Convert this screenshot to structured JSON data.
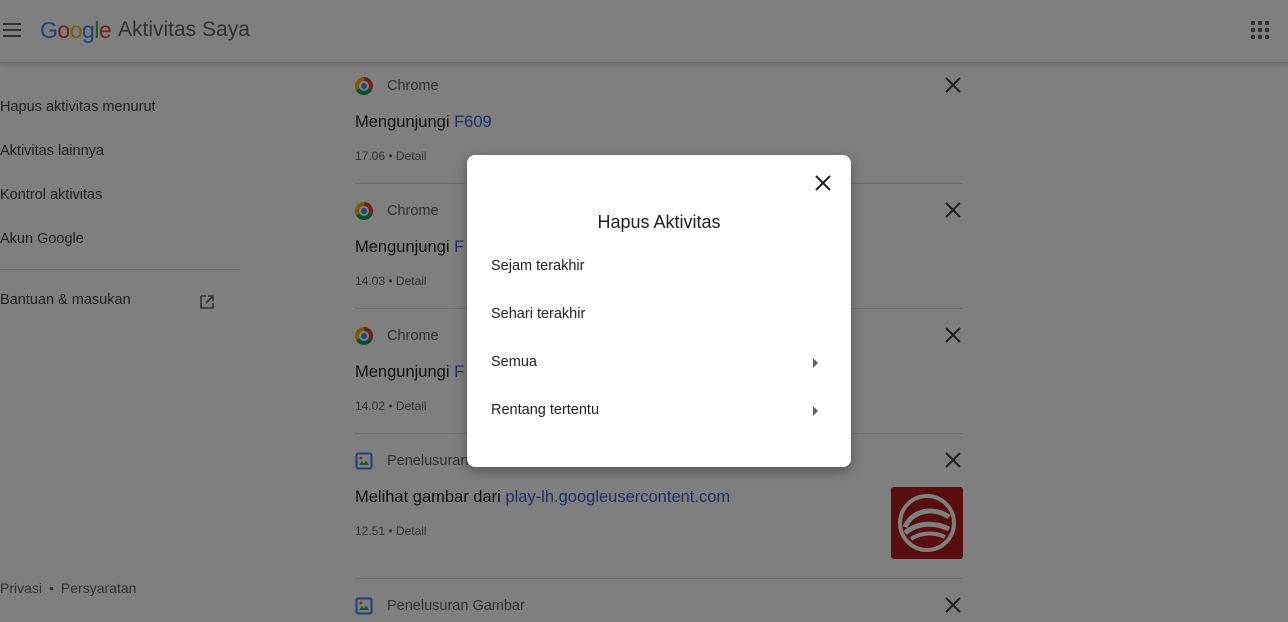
{
  "header": {
    "logo_letters": [
      "G",
      "o",
      "o",
      "g",
      "l",
      "e"
    ],
    "title": "Aktivitas Saya",
    "icons": {
      "menu": "menu-icon",
      "apps": "apps-grid-icon"
    }
  },
  "sidebar": {
    "items": [
      {
        "label": "Hapus aktivitas menurut"
      },
      {
        "label": "Aktivitas lainnya"
      },
      {
        "label": "Kontrol aktivitas"
      },
      {
        "label": "Akun Google",
        "icon": "open-in-new-icon"
      },
      {
        "label": "Bantuan & masukan"
      }
    ],
    "footer": {
      "privacy": "Privasi",
      "separator": "•",
      "terms": "Persyaratan"
    }
  },
  "activity": [
    {
      "product": "Chrome",
      "title_prefix": "Mengunjungi",
      "link": "F609",
      "time": "17.06",
      "detail": "Detail"
    },
    {
      "product": "Chrome",
      "title_prefix": "Mengunjungi",
      "link": "F",
      "time": "14.03",
      "detail": "Detail"
    },
    {
      "product": "Chrome",
      "title_prefix": "Mengunjungi",
      "link": "F",
      "time": "14.02",
      "detail": "Detail"
    },
    {
      "product": "Penelusuran",
      "title_prefix": "Melihat gambar dari",
      "link": "play-lh.googleusercontent.com",
      "time": "12.51",
      "detail": "Detail"
    },
    {
      "product": "Penelusuran Gambar"
    }
  ],
  "meta_separator": "•",
  "dialog": {
    "title": "Hapus Aktivitas",
    "options": [
      {
        "label": "Sejam terakhir",
        "has_submenu": false
      },
      {
        "label": "Sehari terakhir",
        "has_submenu": false
      },
      {
        "label": "Semua",
        "has_submenu": true
      },
      {
        "label": "Rentang tertentu",
        "has_submenu": true
      }
    ]
  },
  "colors": {
    "link": "#3c5fd1",
    "text": "#202124",
    "secondary": "#5f6368",
    "thumbnail": "#b11d1d",
    "scrim": "rgba(0,0,0,0.5)"
  }
}
